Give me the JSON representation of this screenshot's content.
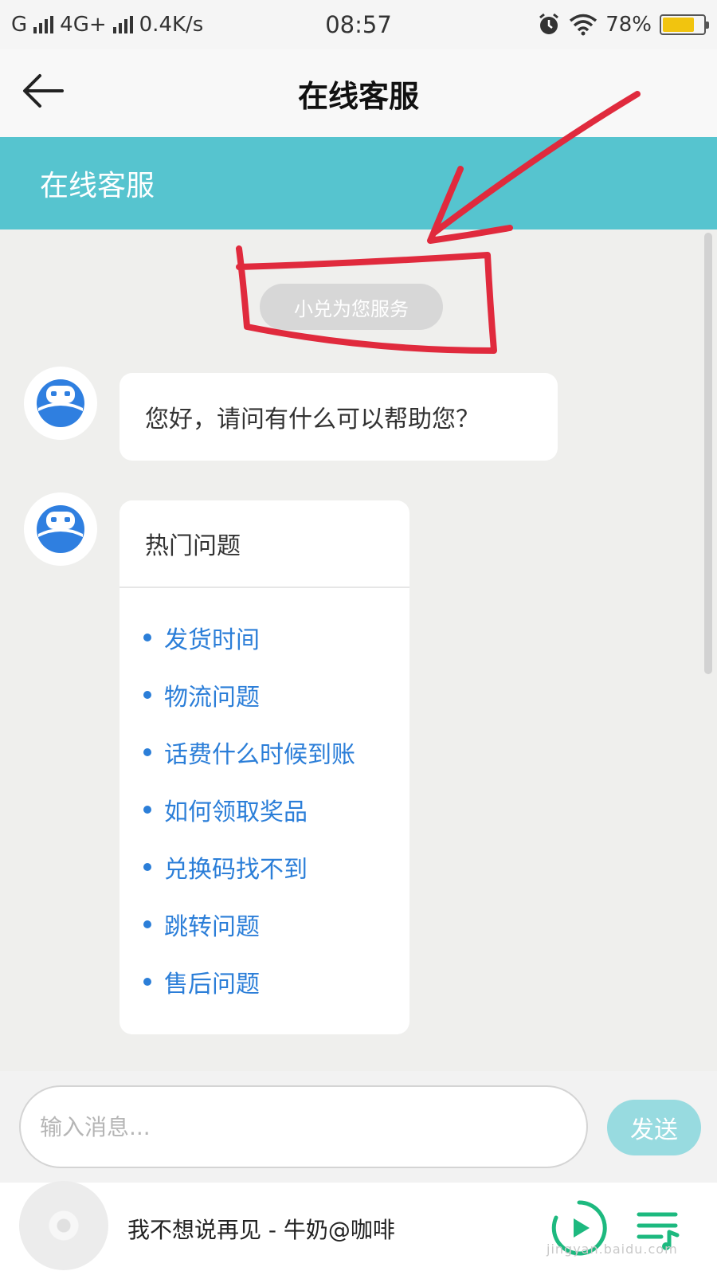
{
  "status_bar": {
    "carrier1": "G",
    "network": "4G+",
    "speed": "0.4K/s",
    "time": "08:57",
    "battery": "78%",
    "battery_level": 0.78
  },
  "header": {
    "title": "在线客服"
  },
  "banner": {
    "title": "在线客服"
  },
  "chat": {
    "service_tag": "小兑为您服务",
    "greeting": "您好，请问有什么可以帮助您？",
    "faq_title": "热门问题",
    "faq_items": [
      "发货时间",
      "物流问题",
      "话费什么时候到账",
      "如何领取奖品",
      "兑换码找不到",
      "跳转问题",
      "售后问题"
    ]
  },
  "input_bar": {
    "placeholder": "输入消息...",
    "send_label": "发送"
  },
  "music": {
    "song": "我不想说再见 - 牛奶@咖啡",
    "watermark": "jingyan.baidu.com"
  },
  "colors": {
    "teal": "#56c4cf",
    "link_blue": "#2b7ed8",
    "send_disabled": "#98dbe0",
    "annotation_red": "#e02a3d"
  },
  "icons": [
    "back-arrow-icon",
    "robot-avatar-icon",
    "play-icon",
    "playlist-icon",
    "alarm-icon",
    "wifi-icon",
    "battery-icon",
    "signal-icon"
  ]
}
